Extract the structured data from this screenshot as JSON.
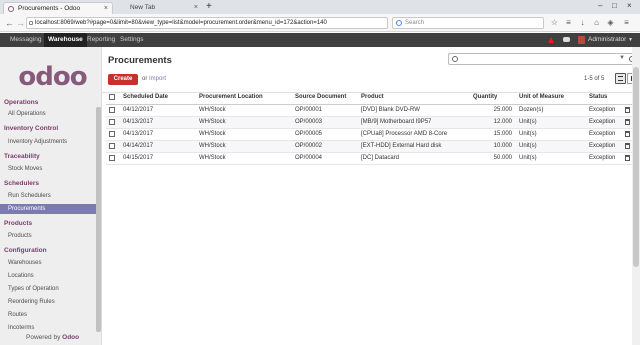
{
  "browser": {
    "active_tab_title": "Procurements - Odoo",
    "inactive_tab_title": "New Tab",
    "url": "localhost:8069/web?#page=0&limit=80&view_type=list&model=procurement.order&menu_id=172&action=140",
    "search_placeholder": "Search"
  },
  "topmenu": {
    "items": [
      "Messaging",
      "Warehouse",
      "Reporting",
      "Settings"
    ],
    "active": "Warehouse",
    "user": "Administrator"
  },
  "sidebar": {
    "logo": "odoo",
    "sections": [
      {
        "title": "Operations",
        "items": [
          "All Operations"
        ]
      },
      {
        "title": "Inventory Control",
        "items": [
          "Inventory Adjustments"
        ]
      },
      {
        "title": "Traceability",
        "items": [
          "Stock Moves"
        ]
      },
      {
        "title": "Schedulers",
        "items": [
          "Run Schedulers",
          "Procurements"
        ]
      },
      {
        "title": "Products",
        "items": [
          "Products"
        ]
      },
      {
        "title": "Configuration",
        "items": [
          "Warehouses",
          "Locations",
          "Types of Operation",
          "Reordering Rules",
          "Routes",
          "Incoterms"
        ]
      }
    ],
    "active_item": "Procurements",
    "powered_by": "Powered by",
    "powered_brand": "Odoo"
  },
  "main": {
    "breadcrumb": "Procurements",
    "create_label": "Create",
    "or_label": "or",
    "import_label": "Import",
    "pager": "1-5 of 5"
  },
  "table": {
    "columns": [
      "Scheduled Date",
      "Procurement Location",
      "Source Document",
      "Product",
      "Quantity",
      "Unit of Measure",
      "Status"
    ],
    "rows": [
      [
        "04/12/2017",
        "WH/Stock",
        "OP/00001",
        "[DVD] Blank DVD-RW",
        "25.000",
        "Dozen(s)",
        "Exception"
      ],
      [
        "04/13/2017",
        "WH/Stock",
        "OP/00003",
        "[MB/9] Motherboard I9P57",
        "12.000",
        "Unit(s)",
        "Exception"
      ],
      [
        "04/13/2017",
        "WH/Stock",
        "OP/00005",
        "[CPUa8] Processor AMD 8-Core",
        "15.000",
        "Unit(s)",
        "Exception"
      ],
      [
        "04/14/2017",
        "WH/Stock",
        "OP/00002",
        "[EXT-HDD] External Hard disk",
        "10.000",
        "Unit(s)",
        "Exception"
      ],
      [
        "04/15/2017",
        "WH/Stock",
        "OP/00004",
        "[DC] Datacard",
        "50.000",
        "Unit(s)",
        "Exception"
      ]
    ]
  }
}
